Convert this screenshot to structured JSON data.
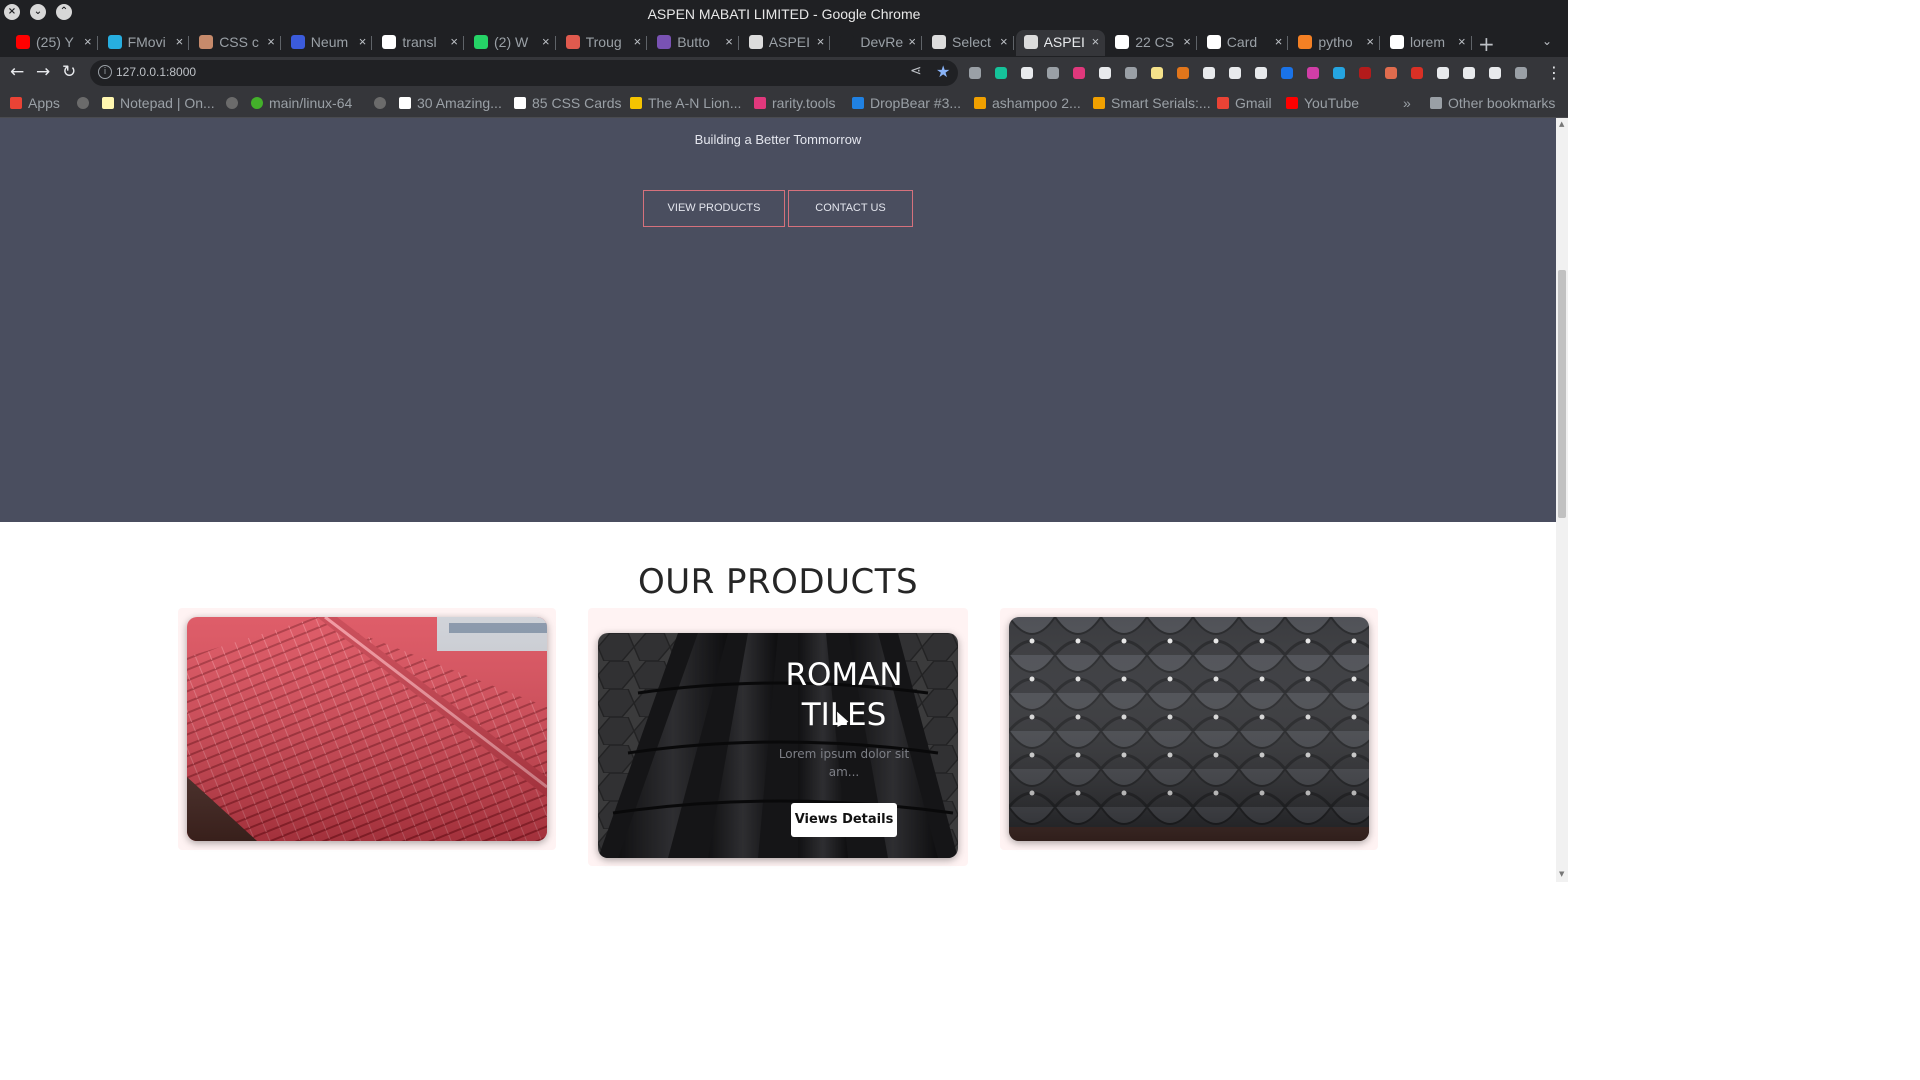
{
  "window": {
    "title": "ASPEN MABATI LIMITED - Google Chrome"
  },
  "tabs": [
    {
      "label": "(25) Y",
      "icon": "youtube-icon",
      "color": "#ff0000"
    },
    {
      "label": "FMovi",
      "icon": "play-icon",
      "color": "#27aee0"
    },
    {
      "label": "CSS c",
      "icon": "avatar-icon",
      "color": "#c68a6b"
    },
    {
      "label": "Neum",
      "icon": "square-icon",
      "color": "#3b5bdb"
    },
    {
      "label": "transl",
      "icon": "google-icon",
      "color": "#ffffff"
    },
    {
      "label": "(2) W",
      "icon": "whatsapp-icon",
      "color": "#25d366"
    },
    {
      "label": "Troug",
      "icon": "image-icon",
      "color": "#e05a4e"
    },
    {
      "label": "Butto",
      "icon": "bootstrap-icon",
      "color": "#7952b3"
    },
    {
      "label": "ASPEI",
      "icon": "globe-icon",
      "color": "#dcdcdc"
    },
    {
      "label": "DevRe",
      "icon": "blank-icon",
      "color": "#1f2023"
    },
    {
      "label": "Select",
      "icon": "globe-icon",
      "color": "#dcdcdc"
    },
    {
      "label": "ASPEI",
      "icon": "globe-icon",
      "color": "#dcdcdc",
      "active": true
    },
    {
      "label": "22 CS",
      "icon": "f-icon",
      "color": "#ffffff"
    },
    {
      "label": "Card",
      "icon": "codepen-icon",
      "color": "#ffffff"
    },
    {
      "label": "pytho",
      "icon": "stackoverflow-icon",
      "color": "#f48024"
    },
    {
      "label": "lorem",
      "icon": "google-icon",
      "color": "#ffffff"
    }
  ],
  "address_bar": {
    "url": "127.0.0.1:8000"
  },
  "bookmarks": [
    {
      "label": "Apps",
      "icon": "apps-grid-icon",
      "color": "#ea4335"
    },
    {
      "label": "",
      "icon": "globe-icon",
      "color": "#6b6b6b"
    },
    {
      "label": "Notepad | On...",
      "icon": "notepad-icon",
      "color": "#fff7b0"
    },
    {
      "label": "",
      "icon": "globe-icon",
      "color": "#6b6b6b"
    },
    {
      "label": "main/linux-64",
      "icon": "ring-icon",
      "color": "#43b02a"
    },
    {
      "label": "",
      "icon": "globe-icon",
      "color": "#6b6b6b"
    },
    {
      "label": "30 Amazing...",
      "icon": "codepen-icon",
      "color": "#ffffff"
    },
    {
      "label": "85 CSS Cards",
      "icon": "f-icon",
      "color": "#ffffff"
    },
    {
      "label": "The A-N Lion...",
      "icon": "lion-icon",
      "color": "#f5c400"
    },
    {
      "label": "rarity.tools",
      "icon": "rt-icon",
      "color": "#e0387c"
    },
    {
      "label": "DropBear #3...",
      "icon": "opensea-icon",
      "color": "#2081e2"
    },
    {
      "label": "ashampoo 2...",
      "icon": "arrow-icon",
      "color": "#f0a000"
    },
    {
      "label": "Smart Serials:...",
      "icon": "arrow-icon",
      "color": "#f0a000"
    },
    {
      "label": "Gmail",
      "icon": "gmail-icon",
      "color": "#ea4335"
    },
    {
      "label": "YouTube",
      "icon": "youtube-icon",
      "color": "#ff0000"
    }
  ],
  "bookmarks_overflow": "»",
  "other_bookmarks": "Other bookmarks",
  "hero": {
    "tagline": "Building a Better Tommorrow",
    "buttons": {
      "products": "VIEW PRODUCTS",
      "contact": "CONTACT US"
    }
  },
  "products": {
    "title": "OUR PRODUCTS",
    "featured": {
      "title": "ROMAN TILES",
      "description": "Lorem ipsum dolor sit am...",
      "button": "Views Details"
    }
  },
  "colors": {
    "hero_bg": "#4a4e5f",
    "button_border": "#d6717c",
    "card_bg": "#fff3f3"
  }
}
